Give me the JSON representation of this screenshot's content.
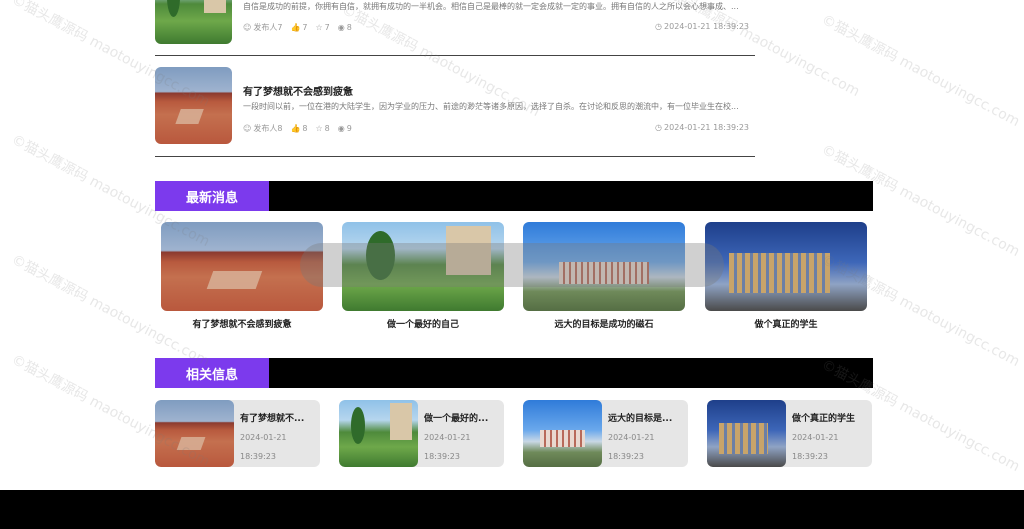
{
  "articles": [
    {
      "title": "",
      "excerpt": "自信是成功的前提，你拥有自信，就拥有成功的一半机会。相信自己是最棒的就一定会成就一定的事业。拥有自信的人之所以会心想事成、...",
      "author": "发布人7",
      "likes": "7",
      "favorites": "7",
      "views": "8",
      "time": "2024-01-21 18:39:23",
      "image": "ph-park"
    },
    {
      "title": "有了梦想就不会感到疲惫",
      "excerpt": "一段时间以前，一位在港的大陆学生，因为学业的压力、前途的渺茫等诸多原因，选择了自杀。在讨论和反思的潮流中，有一位毕业生在校...",
      "author": "发布人8",
      "likes": "8",
      "favorites": "8",
      "views": "9",
      "time": "2024-01-21 18:39:23",
      "image": "ph-red"
    }
  ],
  "sections": {
    "latest": "最新消息",
    "related": "相关信息"
  },
  "latest_news": [
    {
      "caption": "有了梦想就不会感到疲惫",
      "image": "ph-red"
    },
    {
      "caption": "做一个最好的自己",
      "image": "ph-park"
    },
    {
      "caption": "远大的目标是成功的磁石",
      "image": "ph-build"
    },
    {
      "caption": "做个真正的学生",
      "image": "ph-night"
    }
  ],
  "related": [
    {
      "title": "有了梦想就不...",
      "date": "2024-01-21",
      "time": "18:39:23",
      "image": "ph-red"
    },
    {
      "title": "做一个最好的...",
      "date": "2024-01-21",
      "time": "18:39:23",
      "image": "ph-park"
    },
    {
      "title": "远大的目标是...",
      "date": "2024-01-21",
      "time": "18:39:23",
      "image": "ph-build"
    },
    {
      "title": "做个真正的学生",
      "date": "2024-01-21",
      "time": "18:39:23",
      "image": "ph-night"
    }
  ],
  "watermark": "©猫头鹰源码 maotouyingcc.com",
  "colors": {
    "accent": "#7c3aed",
    "header_bar": "#000000"
  }
}
